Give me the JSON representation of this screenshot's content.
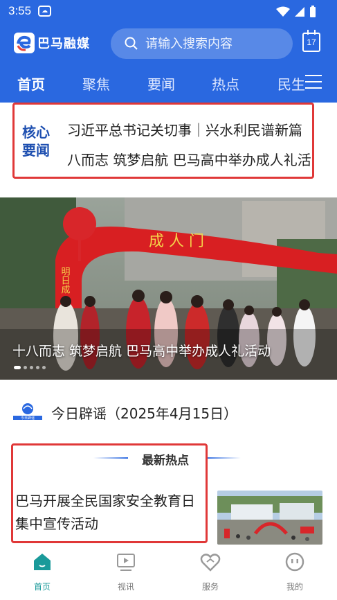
{
  "status_bar": {
    "time": "3:55"
  },
  "header": {
    "app_name": "巴马融媒",
    "search_placeholder": "请输入搜索内容",
    "calendar_day": "17"
  },
  "tabs": [
    {
      "label": "首页",
      "active": true
    },
    {
      "label": "聚焦",
      "active": false
    },
    {
      "label": "要闻",
      "active": false
    },
    {
      "label": "热点",
      "active": false
    },
    {
      "label": "民生",
      "active": false
    }
  ],
  "core_news": {
    "badge_line1": "核心",
    "badge_line2": "要闻",
    "headline_1": "习近平总书记关切事｜兴水利民谱新篇",
    "headline_2": "八而志 筑梦启航  巴马高中举办成人礼活"
  },
  "hero": {
    "caption": "十八而志 筑梦启航  巴马高中举办成人礼活动",
    "arch_text": "成 人 门",
    "pillar_text": "明日成",
    "slide_count": 5,
    "active_slide": 1
  },
  "rumor": {
    "source_logo_text": "今日辟谣",
    "title": "今日辟谣（2025年4月15日）"
  },
  "hot": {
    "section_label": "最新热点",
    "news_title": "巴马开展全民国家安全教育日集中宣传活动"
  },
  "bottom_nav": [
    {
      "label": "首页",
      "icon": "home-icon",
      "active": true
    },
    {
      "label": "视讯",
      "icon": "video-icon",
      "active": false
    },
    {
      "label": "服务",
      "icon": "service-icon",
      "active": false
    },
    {
      "label": "我的",
      "icon": "profile-icon",
      "active": false
    }
  ],
  "colors": {
    "brand_blue": "#2a68e0",
    "highlight_red": "#e03838",
    "nav_active": "#1a9a9a"
  }
}
